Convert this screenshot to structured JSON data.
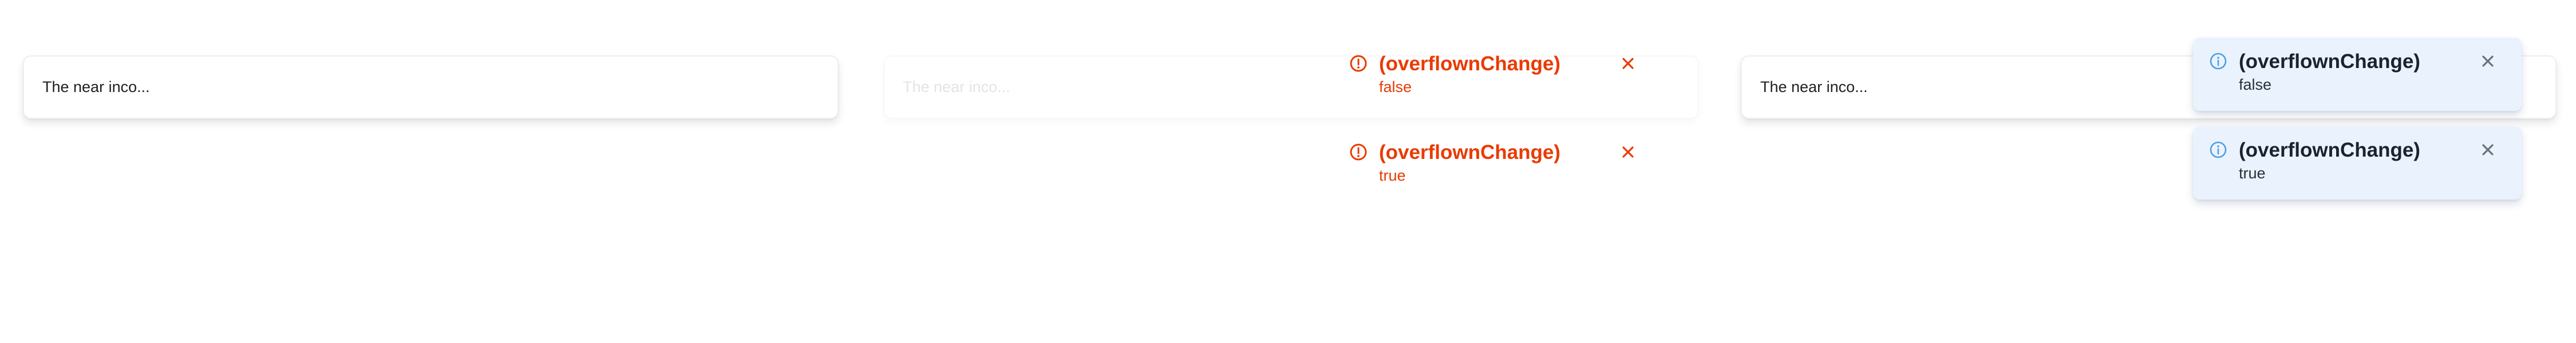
{
  "panels": [
    {
      "textbox": {
        "text": "The near inco..."
      },
      "toasts": []
    },
    {
      "textbox": {
        "text": "The near inco..."
      },
      "toasts": [
        {
          "variant": "error",
          "icon": "alert-circle-icon",
          "title": "(overflownChange)",
          "body": "false"
        },
        {
          "variant": "error",
          "icon": "alert-circle-icon",
          "title": "(overflownChange)",
          "body": "true"
        }
      ]
    },
    {
      "textbox": {
        "text": "The near inco..."
      },
      "toasts": [
        {
          "variant": "info",
          "icon": "info-circle-icon",
          "title": "(overflownChange)",
          "body": "false"
        },
        {
          "variant": "info",
          "icon": "info-circle-icon",
          "title": "(overflownChange)",
          "body": "true"
        }
      ]
    }
  ],
  "colors": {
    "error": "#ea3a00",
    "info_icon": "#4f9fe0",
    "info_background": "#eaf3fd",
    "close_gray": "#6b6f78"
  }
}
